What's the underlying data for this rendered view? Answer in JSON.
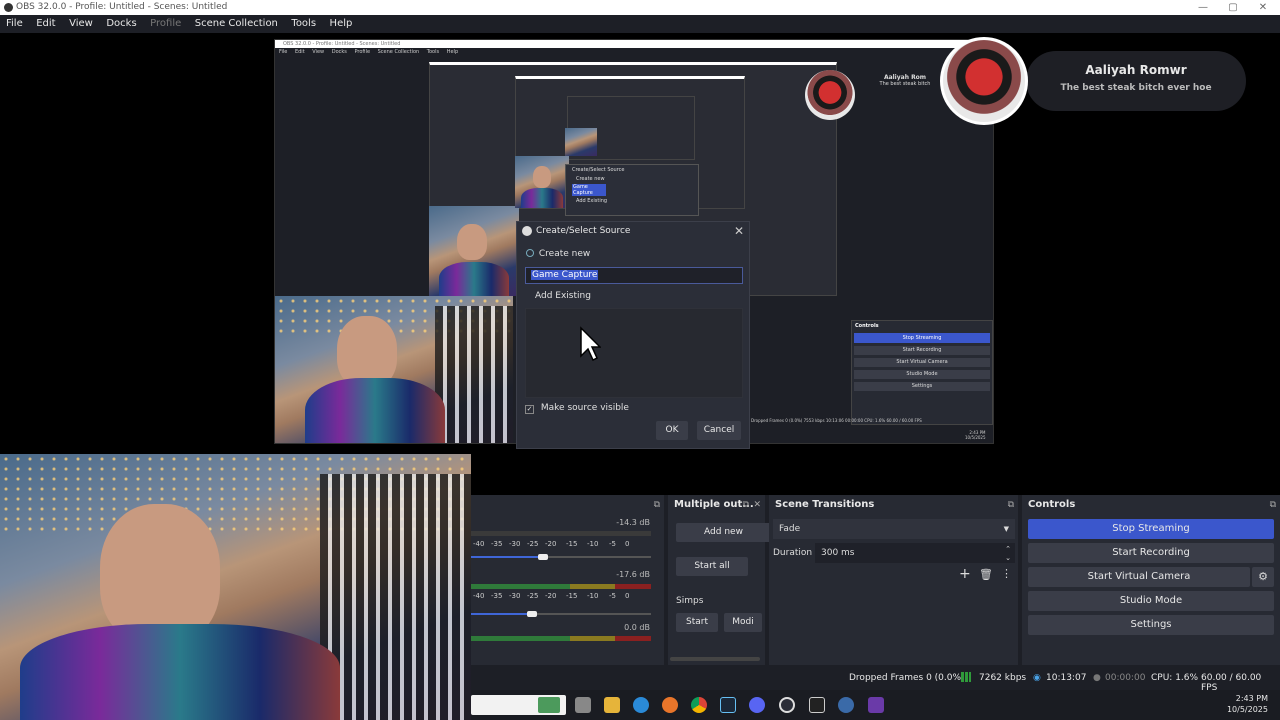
{
  "window": {
    "title": "OBS 32.0.0 - Profile: Untitled - Scenes: Untitled",
    "min": "—",
    "max": "▢",
    "close": "✕"
  },
  "menu": [
    "File",
    "Edit",
    "View",
    "Docks",
    "Profile",
    "Scene Collection",
    "Tools",
    "Help"
  ],
  "nested": {
    "title": "OBS 32.0.0 - Profile: Untitled - Scenes: Untitled",
    "menu": [
      "File",
      "Edit",
      "View",
      "Docks",
      "Profile",
      "Scene Collection",
      "Tools",
      "Help"
    ],
    "controls": [
      "Stop Streaming",
      "Start Recording",
      "Start Virtual Camera",
      "Studio Mode",
      "Settings"
    ],
    "controls_title": "Controls",
    "status": "Dropped Frames 0 (0.0%)   7553 kbps   10:13:06   00:00:00   CPU: 1.6%   60.00 / 60.00 FPS",
    "time": "2:43 PM",
    "date": "10/5/2025",
    "dlg_title": "Create/Select Source",
    "dlg_create": "Create new",
    "dlg_value": "Game Capture",
    "dlg_existing": "Add Existing"
  },
  "overlay": {
    "name": "Aaliyah Romwr",
    "subtitle": "The best steak bitch ever hoe",
    "small_name": "Aaliyah Rom",
    "small_sub": "The best steak bitch"
  },
  "dialog": {
    "title": "Create/Select Source",
    "close": "✕",
    "create_new_label": "Create new",
    "name_value": "Game Capture",
    "add_existing_label": "Add Existing",
    "make_visible_label": "Make source visible",
    "make_visible_checked": true,
    "ok_label": "OK",
    "cancel_label": "Cancel"
  },
  "audio": {
    "tracks": [
      {
        "db": "-14.3 dB",
        "volume_fraction": 0.4
      },
      {
        "db": "-17.6 dB",
        "volume_fraction": 0.34
      },
      {
        "db": "0.0 dB",
        "volume_fraction": null
      }
    ],
    "scale": [
      "-60",
      "-40",
      "-35",
      "-30",
      "-25",
      "-20",
      "-15",
      "-10",
      "-5",
      "0"
    ]
  },
  "multiple_output": {
    "title": "Multiple out...",
    "add_new": "Add new",
    "start_all": "Start all",
    "group": "Simps",
    "start": "Start",
    "modify": "Modi"
  },
  "transitions": {
    "title": "Scene Transitions",
    "selected": "Fade",
    "duration_label": "Duration",
    "duration_value": "300 ms"
  },
  "controls": {
    "title": "Controls",
    "stop_streaming": "Stop Streaming",
    "start_recording": "Start Recording",
    "start_virtual_camera": "Start Virtual Camera",
    "studio_mode": "Studio Mode",
    "settings": "Settings"
  },
  "status": {
    "dropped": "Dropped Frames 0 (0.0%)",
    "kbps": "7262 kbps",
    "stream_time": "10:13:07",
    "rec_time": "00:00:00",
    "cpu": "CPU: 1.6%",
    "fps": "60.00 / 60.00 FPS"
  },
  "taskbar": {
    "time": "2:43 PM",
    "date": "10/5/2025"
  },
  "colors": {
    "accent": "#3b57cc",
    "background": "#1d1f26",
    "panel": "#272a33"
  }
}
